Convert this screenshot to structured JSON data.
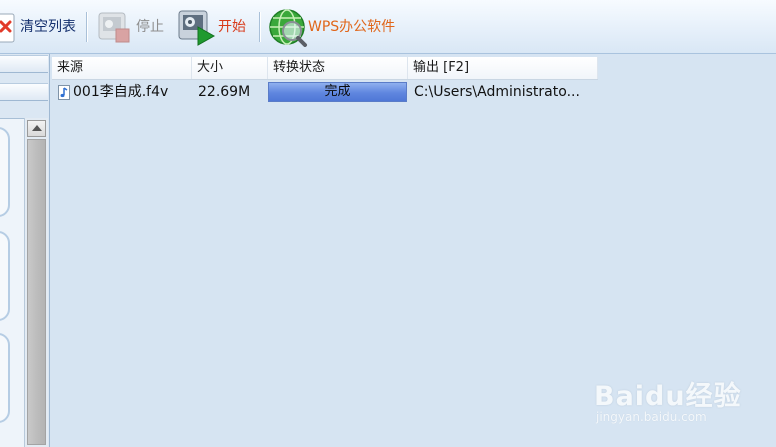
{
  "toolbar": {
    "clear_label": "清空列表",
    "stop_label": "停止",
    "start_label": "开始",
    "wps_label": "WPS办公软件"
  },
  "list": {
    "columns": [
      "来源",
      "大小",
      "转换状态",
      "输出 [F2]"
    ],
    "rows": [
      {
        "source": "001李自成.f4v",
        "size": "22.69M",
        "status": "完成",
        "output": "C:\\Users\\Administrato..."
      }
    ]
  },
  "watermark": {
    "brand": "Baidu经验",
    "url": "jingyan.baidu.com"
  },
  "colors": {
    "status_fill": "#5f86df",
    "start_label": "#d83a1a",
    "wps_label": "#e0661a",
    "stop_label": "#8e8e8e",
    "clear_label": "#15306e"
  }
}
